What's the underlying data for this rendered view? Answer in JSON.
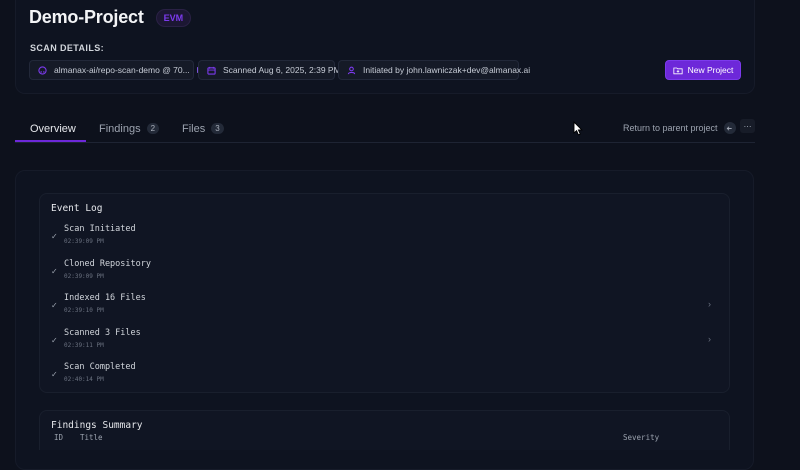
{
  "project": {
    "title": "Demo-Project",
    "badge": "EVM"
  },
  "scan_details": {
    "label": "SCAN DETAILS:",
    "repo": "almanax-ai/repo-scan-demo @ 70...",
    "scanned": "Scanned Aug 6, 2025, 2:39 PM",
    "initiated": "Initiated by john.lawniczak+dev@almanax.ai"
  },
  "actions": {
    "new_project": "New Project"
  },
  "tabs": [
    {
      "label": "Overview"
    },
    {
      "label": "Findings",
      "count": "2"
    },
    {
      "label": "Files",
      "count": "3"
    }
  ],
  "nav": {
    "return": "Return to parent project"
  },
  "event_log": {
    "title": "Event Log",
    "events": [
      {
        "title": "Scan Initiated",
        "time": "02:39:09 PM"
      },
      {
        "title": "Cloned Repository",
        "time": "02:39:09 PM"
      },
      {
        "title": "Indexed 16 Files",
        "time": "02:39:10 PM"
      },
      {
        "title": "Scanned 3 Files",
        "time": "02:39:11 PM"
      },
      {
        "title": "Scan Completed",
        "time": "02:40:14 PM"
      }
    ]
  },
  "findings_summary": {
    "title": "Findings Summary",
    "columns": [
      "ID",
      "Title",
      "Severity"
    ]
  }
}
